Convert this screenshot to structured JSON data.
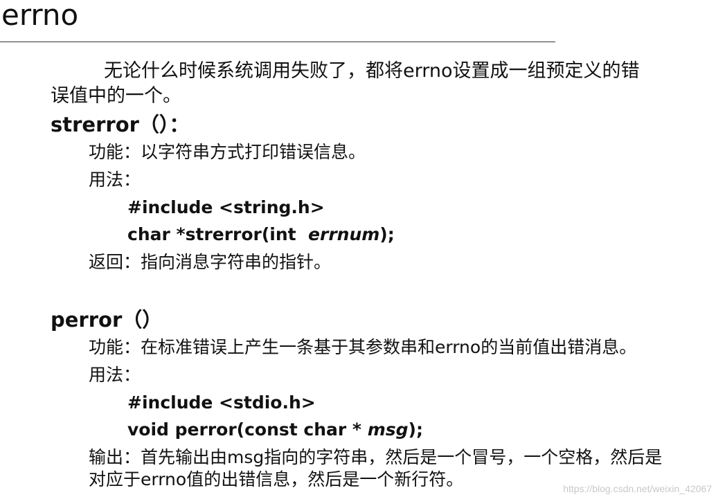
{
  "title": "errno",
  "intro": {
    "line1": "无论什么时候系统调用失败了，都将errno设置成一组预定义的错",
    "line2": "误值中的一个。"
  },
  "strerror": {
    "heading": "strerror（）：",
    "function": "功能：以字符串方式打印错误信息。",
    "usage": "用法：",
    "include": "#include <string.h>",
    "prototype_prefix": "char *strerror(int  ",
    "prototype_param": "errnum",
    "prototype_suffix": ");",
    "returns": "返回：指向消息字符串的指针。"
  },
  "perror": {
    "heading": "perror（）",
    "function": "功能：在标准错误上产生一条基于其参数串和errno的当前值出错消息。",
    "usage": "用法：",
    "include": "#include <stdio.h>",
    "prototype_prefix": "void perror(const char * ",
    "prototype_param": "msg",
    "prototype_suffix": ");",
    "output_line1": "输出：首先输出由msg指向的字符串，然后是一个冒号，一个空格，然后是",
    "output_line2": "对应于errno值的出错信息，然后是一个新行符。"
  },
  "watermark": "https://blog.csdn.net/weixin_42067"
}
